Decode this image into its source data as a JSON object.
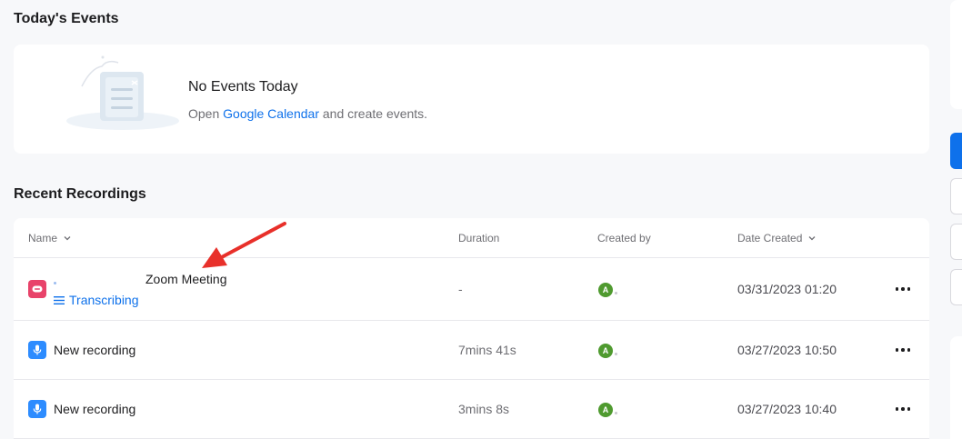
{
  "events": {
    "section_title": "Today's Events",
    "headline": "No Events Today",
    "sub_prefix": "Open ",
    "sub_link": "Google Calendar",
    "sub_suffix": " and create events."
  },
  "recordings": {
    "section_title": "Recent Recordings",
    "columns": {
      "name": "Name",
      "duration": "Duration",
      "created_by": "Created by",
      "date_created": "Date Created"
    },
    "rows": [
      {
        "name": "Zoom Meeting",
        "status": "Transcribing",
        "duration": "-",
        "creator_initial": "A",
        "date": "03/31/2023 01:20",
        "icon": "zoom-meeting-icon"
      },
      {
        "name": "New recording",
        "duration": "7mins 41s",
        "creator_initial": "A",
        "date": "03/27/2023 10:50",
        "icon": "microphone-icon"
      },
      {
        "name": "New recording",
        "duration": "3mins 8s",
        "creator_initial": "A",
        "date": "03/27/2023 10:40",
        "icon": "microphone-icon"
      }
    ]
  },
  "colors": {
    "accent": "#0e71eb",
    "zoom_icon": "#e8436a",
    "mic_icon": "#2d8cff",
    "avatar": "#4f9a2f",
    "annotation_arrow": "#e8302a"
  }
}
